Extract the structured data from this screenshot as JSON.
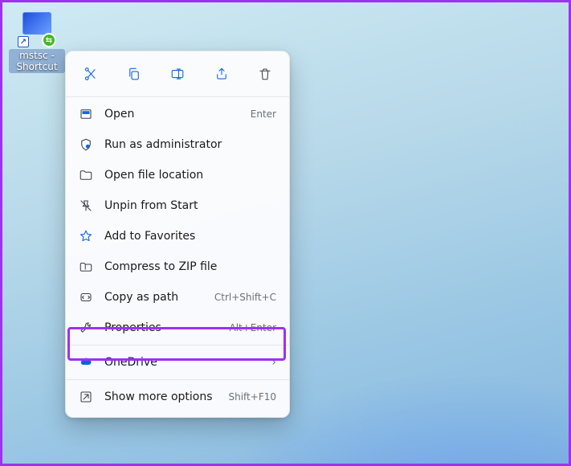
{
  "desktop_icon": {
    "label": "mstsc - Shortcut"
  },
  "quick_actions": [
    "Cut",
    "Copy",
    "Rename",
    "Share",
    "Delete"
  ],
  "menu": {
    "open": {
      "label": "Open",
      "shortcut": "Enter"
    },
    "runadmin": {
      "label": "Run as administrator",
      "shortcut": ""
    },
    "openloc": {
      "label": "Open file location",
      "shortcut": ""
    },
    "unpin": {
      "label": "Unpin from Start",
      "shortcut": ""
    },
    "fav": {
      "label": "Add to Favorites",
      "shortcut": ""
    },
    "zip": {
      "label": "Compress to ZIP file",
      "shortcut": ""
    },
    "copypath": {
      "label": "Copy as path",
      "shortcut": "Ctrl+Shift+C"
    },
    "properties": {
      "label": "Properties",
      "shortcut": "Alt+Enter"
    },
    "onedrive": {
      "label": "OneDrive",
      "shortcut": ""
    },
    "more": {
      "label": "Show more options",
      "shortcut": "Shift+F10"
    }
  }
}
